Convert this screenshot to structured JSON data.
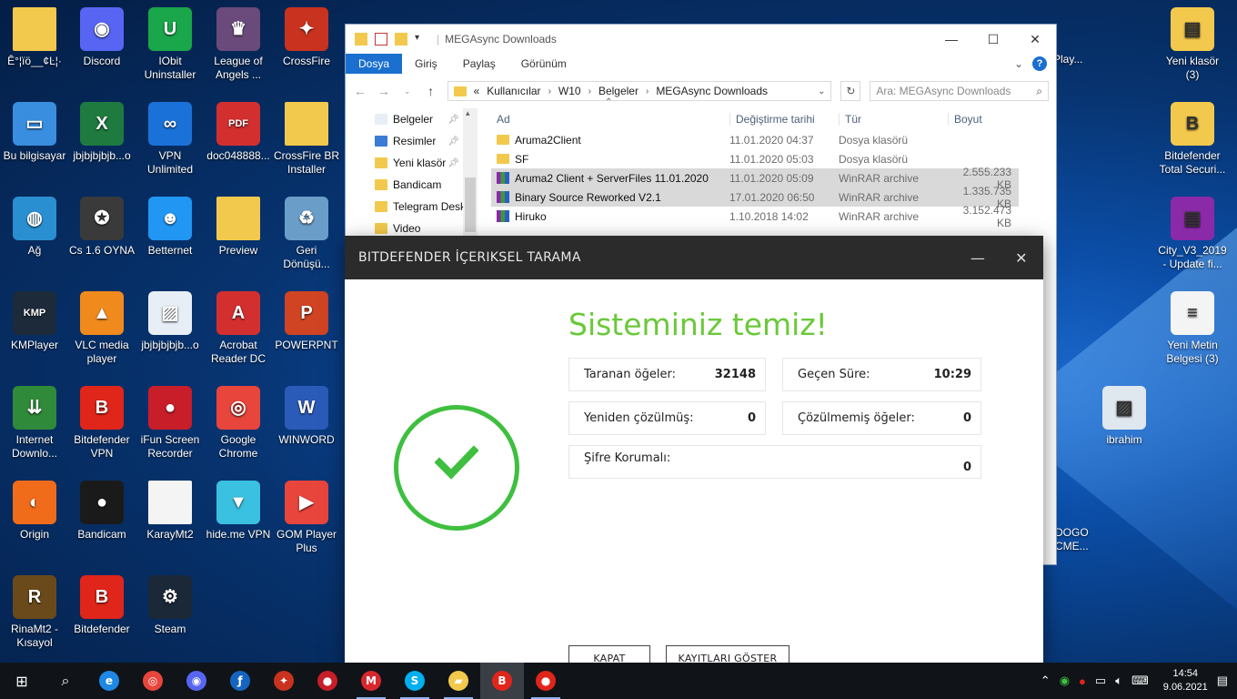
{
  "desktop": {
    "icons": [
      {
        "label": "Ê°¦ïö__¢Ŀ¦·",
        "icon": "folder-icon",
        "color": "#f2c94c",
        "glyph": ""
      },
      {
        "label": "Discord",
        "icon": "discord-icon",
        "color": "#5865f2",
        "glyph": "◉"
      },
      {
        "label": "IObit Uninstaller",
        "icon": "iobit-icon",
        "color": "#1aa64a",
        "glyph": "U"
      },
      {
        "label": "League of Angels ...",
        "icon": "game-icon",
        "color": "#6a4a7a",
        "glyph": "♛"
      },
      {
        "label": "CrossFire",
        "icon": "crossfire-icon",
        "color": "#c8321e",
        "glyph": "✦"
      },
      {
        "label": "Bu bilgisayar",
        "icon": "computer-icon",
        "color": "#3a8ee0",
        "glyph": "▭"
      },
      {
        "label": "jbjbjbjbjb...o",
        "icon": "excel-icon",
        "color": "#1f7a3f",
        "glyph": "X"
      },
      {
        "label": "VPN Unlimited",
        "icon": "vpn-icon",
        "color": "#1a72d9",
        "glyph": "∞"
      },
      {
        "label": "doc048888...",
        "icon": "pdf-icon",
        "color": "#d32f2f",
        "glyph": "PDF"
      },
      {
        "label": "CrossFire BR Installer",
        "icon": "folder-icon",
        "color": "#f2c94c",
        "glyph": ""
      },
      {
        "label": "Ağ",
        "icon": "network-icon",
        "color": "#2a8fd0",
        "glyph": "◍"
      },
      {
        "label": "Cs 1.6 OYNA",
        "icon": "counterstrike-icon",
        "color": "#3a3a3a",
        "glyph": "✪"
      },
      {
        "label": "Betternet",
        "icon": "betternet-icon",
        "color": "#2196f3",
        "glyph": "☻"
      },
      {
        "label": "Preview",
        "icon": "folder-icon",
        "color": "#f2c94c",
        "glyph": ""
      },
      {
        "label": "Geri Dönüşü...",
        "icon": "recycle-bin-icon",
        "color": "#6a9ec9",
        "glyph": "♻"
      },
      {
        "label": "KMPlayer",
        "icon": "kmplayer-icon",
        "color": "#1c2a3a",
        "glyph": "KMP"
      },
      {
        "label": "VLC media player",
        "icon": "vlc-icon",
        "color": "#f08a1c",
        "glyph": "▲"
      },
      {
        "label": "jbjbjbjbjb...o",
        "icon": "image-file-icon",
        "color": "#e8eef5",
        "glyph": "▨"
      },
      {
        "label": "Acrobat Reader DC",
        "icon": "acrobat-icon",
        "color": "#d32f2f",
        "glyph": "A"
      },
      {
        "label": "POWERPNT",
        "icon": "powerpoint-icon",
        "color": "#d04423",
        "glyph": "P"
      },
      {
        "label": "Internet Downlo...",
        "icon": "idm-icon",
        "color": "#2f8a3a",
        "glyph": "⇊"
      },
      {
        "label": "Bitdefender VPN",
        "icon": "bitdefender-vpn-icon",
        "color": "#e0251b",
        "glyph": "B"
      },
      {
        "label": "iFun Screen Recorder",
        "icon": "recorder-icon",
        "color": "#c81e2a",
        "glyph": "●"
      },
      {
        "label": "Google Chrome",
        "icon": "chrome-icon",
        "color": "#e8453c",
        "glyph": "◎"
      },
      {
        "label": "WINWORD",
        "icon": "word-icon",
        "color": "#2b5bb8",
        "glyph": "W"
      },
      {
        "label": "Origin",
        "icon": "origin-icon",
        "color": "#f06b1a",
        "glyph": "◐"
      },
      {
        "label": "Bandicam",
        "icon": "bandicam-icon",
        "color": "#1a1a1a",
        "glyph": "●"
      },
      {
        "label": "KarayMt2",
        "icon": "file-icon",
        "color": "#f4f4f4",
        "glyph": ""
      },
      {
        "label": "hide.me VPN",
        "icon": "hideme-icon",
        "color": "#3ac0e0",
        "glyph": "▼"
      },
      {
        "label": "GOM Player Plus",
        "icon": "gom-icon",
        "color": "#e8453c",
        "glyph": "▶"
      },
      {
        "label": "RinaMt2 - Kısayol",
        "icon": "rina-icon",
        "color": "#6a4a1a",
        "glyph": "R"
      },
      {
        "label": "Bitdefender",
        "icon": "bitdefender-icon",
        "color": "#e0251b",
        "glyph": "B"
      },
      {
        "label": "Steam",
        "icon": "steam-icon",
        "color": "#1b2838",
        "glyph": "⚙"
      }
    ],
    "right_icons": [
      {
        "label": "Yeni klasör (3)",
        "icon": "winrar-folder-icon",
        "color": "#f2c94c",
        "glyph": "▤"
      },
      {
        "label": "Bitdefender Total Securi...",
        "icon": "bitdefender-folder-icon",
        "color": "#f2c94c",
        "glyph": "B"
      },
      {
        "label": "City_V3_2019 - Update fi...",
        "icon": "winrar-icon",
        "color": "#8a2aa8",
        "glyph": "▤"
      },
      {
        "label": "Yeni Metin Belgesi (3)",
        "icon": "text-file-icon",
        "color": "#f4f4f4",
        "glyph": "≡"
      },
      {
        "label": "ibrahim",
        "icon": "image-icon",
        "color": "#dfe7ef",
        "glyph": "▨"
      }
    ],
    "partial_labels": {
      "play": "Play...",
      "dogo": "DOGO",
      "cme": "CME..."
    }
  },
  "explorer": {
    "title": "MEGAsync Downloads",
    "tabs": [
      "Dosya",
      "Giriş",
      "Paylaş",
      "Görünüm"
    ],
    "path": [
      "«",
      "Kullanıcılar",
      "W10",
      "Belgeler",
      "MEGAsync Downloads"
    ],
    "search_placeholder": "Ara: MEGAsync Downloads",
    "nav": [
      {
        "label": "Belgeler",
        "icon": "documents-icon",
        "pinned": true
      },
      {
        "label": "Resimler",
        "icon": "pictures-icon",
        "pinned": true
      },
      {
        "label": "Yeni klasör",
        "icon": "folder-icon",
        "pinned": true
      },
      {
        "label": "Bandicam",
        "icon": "folder-icon",
        "pinned": false
      },
      {
        "label": "Telegram Desk",
        "icon": "folder-icon",
        "pinned": false
      },
      {
        "label": "Video",
        "icon": "folder-icon",
        "pinned": false
      }
    ],
    "columns": [
      "Ad",
      "Değiştirme tarihi",
      "Tür",
      "Boyut"
    ],
    "files": [
      {
        "name": "Aruma2Client",
        "date": "11.01.2020 04:37",
        "type": "Dosya klasörü",
        "size": "",
        "kind": "folder",
        "selected": false
      },
      {
        "name": "SF",
        "date": "11.01.2020 05:03",
        "type": "Dosya klasörü",
        "size": "",
        "kind": "folder",
        "selected": false
      },
      {
        "name": "Aruma2 Client + ServerFiles 11.01.2020",
        "date": "11.01.2020 05:09",
        "type": "WinRAR archive",
        "size": "2.555.233 KB",
        "kind": "rar",
        "selected": true
      },
      {
        "name": "Binary Source Reworked V2.1",
        "date": "17.01.2020 06:50",
        "type": "WinRAR archive",
        "size": "1.335.735 KB",
        "kind": "rar",
        "selected": true
      },
      {
        "name": "Hiruko",
        "date": "1.10.2018 14:02",
        "type": "WinRAR archive",
        "size": "3.152.473 KB",
        "kind": "rar",
        "selected": false
      }
    ]
  },
  "bitdefender": {
    "window_title": "BITDEFENDER İÇERIKSEL TARAMA",
    "headline": "Sisteminiz temiz!",
    "stats": {
      "scanned_label": "Taranan öğeler:",
      "scanned_value": "32148",
      "elapsed_label": "Geçen Süre:",
      "elapsed_value": "10:29",
      "resolved_label": "Yeniden çözülmüş:",
      "resolved_value": "0",
      "unresolved_label": "Çözülmemiş öğeler:",
      "unresolved_value": "0",
      "password_label": "Şifre Korumalı:",
      "password_value": "0"
    },
    "close_button": "KAPAT",
    "logs_button": "KAYITLARI GÖSTER",
    "accent": "#3fbf3f",
    "headline_color": "#6ac93a"
  },
  "taskbar": {
    "apps": [
      {
        "icon": "start-icon",
        "glyph": "⊞",
        "color": "",
        "state": ""
      },
      {
        "icon": "search-icon",
        "glyph": "⌕",
        "color": "",
        "state": ""
      },
      {
        "icon": "edge-icon",
        "glyph": "e",
        "color": "#1e88e5",
        "state": ""
      },
      {
        "icon": "chrome-icon",
        "glyph": "◎",
        "color": "#e8453c",
        "state": ""
      },
      {
        "icon": "discord-icon",
        "glyph": "◉",
        "color": "#5865f2",
        "state": ""
      },
      {
        "icon": "flash-icon",
        "glyph": "ƒ",
        "color": "#1565c0",
        "state": ""
      },
      {
        "icon": "crossfire-icon",
        "glyph": "✦",
        "color": "#c8321e",
        "state": ""
      },
      {
        "icon": "recorder-icon",
        "glyph": "●",
        "color": "#c81e2a",
        "state": ""
      },
      {
        "icon": "mega-icon",
        "glyph": "M",
        "color": "#d9272e",
        "state": "running"
      },
      {
        "icon": "skype-icon",
        "glyph": "S",
        "color": "#00aff0",
        "state": "running"
      },
      {
        "icon": "file-explorer-icon",
        "glyph": "▰",
        "color": "#f2c94c",
        "state": "running"
      },
      {
        "icon": "bitdefender-icon",
        "glyph": "B",
        "color": "#e0251b",
        "state": "active"
      },
      {
        "icon": "record-icon",
        "glyph": "●",
        "color": "#e0251b",
        "state": "running"
      }
    ],
    "tray": {
      "chevron": "⌃",
      "time": "14:54",
      "date": "9.06.2021"
    }
  }
}
